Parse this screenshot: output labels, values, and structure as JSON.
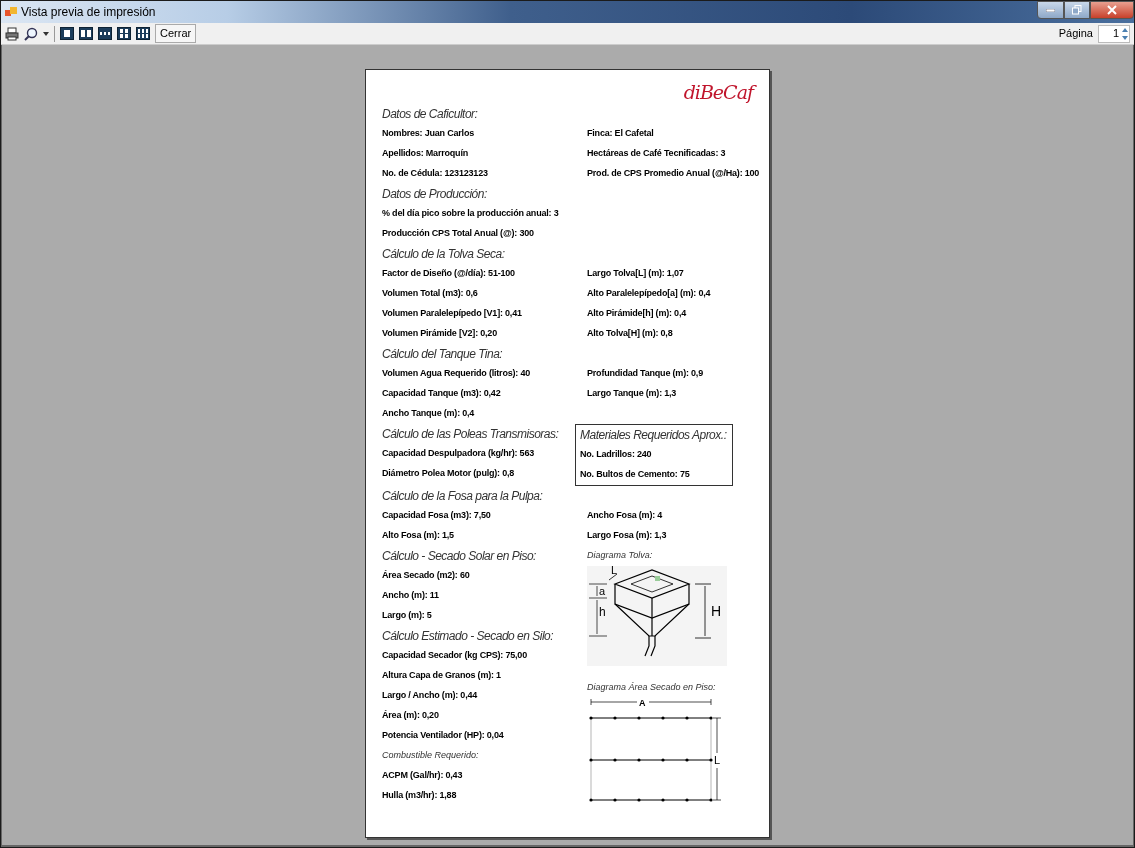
{
  "window": {
    "title": "Vista previa de impresión"
  },
  "toolbar": {
    "close_label": "Cerrar",
    "page_label": "Página",
    "page_value": "1"
  },
  "report": {
    "logo": "diBeCaf",
    "sections": [
      {
        "title": "Datos de Caficultor:",
        "rows": [
          {
            "left": "Nombres: Juan Carlos",
            "right": "Finca: El Cafetal"
          },
          {
            "left": "Apellidos: Marroquín",
            "right": "Hectáreas de Café Tecnificadas: 3"
          },
          {
            "left": "No. de Cédula: 123123123",
            "right": "Prod. de CPS Promedio Anual (@/Ha): 100"
          }
        ]
      },
      {
        "title": "Datos de Producción:",
        "rows": [
          {
            "left": "% del día pico sobre la producción anual: 3"
          },
          {
            "left": "Producción CPS Total Anual (@): 300"
          }
        ]
      },
      {
        "title": "Cálculo de la Tolva Seca:",
        "rows": [
          {
            "left": "Factor de Diseño (@/día): 51-100",
            "right": "Largo Tolva[L] (m): 1,07"
          },
          {
            "left": "Volumen Total (m3): 0,6",
            "right": "Alto Paralelepípedo[a] (m): 0,4"
          },
          {
            "left": "Volumen Paralelepípedo [V1]: 0,41",
            "right": "Alto Pirámide[h] (m): 0,4"
          },
          {
            "left": "Volumen Pirámide [V2]: 0,20",
            "right": "Alto Tolva[H] (m): 0,8"
          }
        ]
      },
      {
        "title": "Cálculo del Tanque Tina:",
        "rows": [
          {
            "left": "Volumen Agua Requerido (litros): 40",
            "right": "Profundidad Tanque (m): 0,9"
          },
          {
            "left": "Capacidad Tanque (m3): 0,42",
            "right": "Largo Tanque (m): 1,3"
          },
          {
            "left": "Ancho Tanque (m): 0,4"
          }
        ]
      },
      {
        "title": "Cálculo de las Poleas Transmisoras:",
        "rows": [
          {
            "left": "Capacidad Despulpadora (kg/hr): 563"
          },
          {
            "left": "Diámetro Polea Motor (pulg): 0,8"
          }
        ],
        "materials": {
          "title": "Materiales Requeridos Aprox.:",
          "items": [
            "No. Ladrillos: 240",
            "No. Bultos de Cemento: 75"
          ]
        }
      },
      {
        "title": "Cálculo de la Fosa para la Pulpa:",
        "rows": [
          {
            "left": "Capacidad Fosa (m3): 7,50",
            "right": "Ancho Fosa (m): 4"
          },
          {
            "left": "Alto Fosa (m): 1,5",
            "right": "Largo Fosa (m): 1,3"
          }
        ]
      }
    ],
    "drying": {
      "sections": [
        {
          "title": "Cálculo - Secado Solar en Piso:",
          "rows": [
            {
              "kind": "field",
              "text": "Área Secado (m2): 60"
            },
            {
              "kind": "field",
              "text": "Ancho (m): 11"
            },
            {
              "kind": "field",
              "text": "Largo (m): 5"
            }
          ]
        },
        {
          "title": "Cálculo Estimado - Secado en Silo:",
          "rows": [
            {
              "kind": "field",
              "text": "Capacidad Secador (kg CPS): 75,00"
            },
            {
              "kind": "field",
              "text": "Altura Capa de Granos (m): 1"
            },
            {
              "kind": "field",
              "text": "Largo / Ancho (m): 0,44"
            },
            {
              "kind": "field",
              "text": "Área (m): 0,20"
            },
            {
              "kind": "field",
              "text": "Potencia Ventilador (HP): 0,04"
            },
            {
              "kind": "subheading",
              "text": "Combustible Requerido:"
            },
            {
              "kind": "field",
              "text": "ACPM (Gal/hr): 0,43"
            },
            {
              "kind": "field",
              "text": "Hulla (m3/hr): 1,88"
            }
          ]
        }
      ],
      "diagrams": [
        {
          "kind": "hopper",
          "label": "Diagrama Tolva:",
          "labels": {
            "length": "L",
            "parallelepiped": "a",
            "pyramid": "h",
            "total": "H"
          }
        },
        {
          "kind": "floor",
          "label": "Diagrama Área Secado en Piso:",
          "labels": {
            "width": "A",
            "length": "L"
          }
        }
      ]
    }
  }
}
